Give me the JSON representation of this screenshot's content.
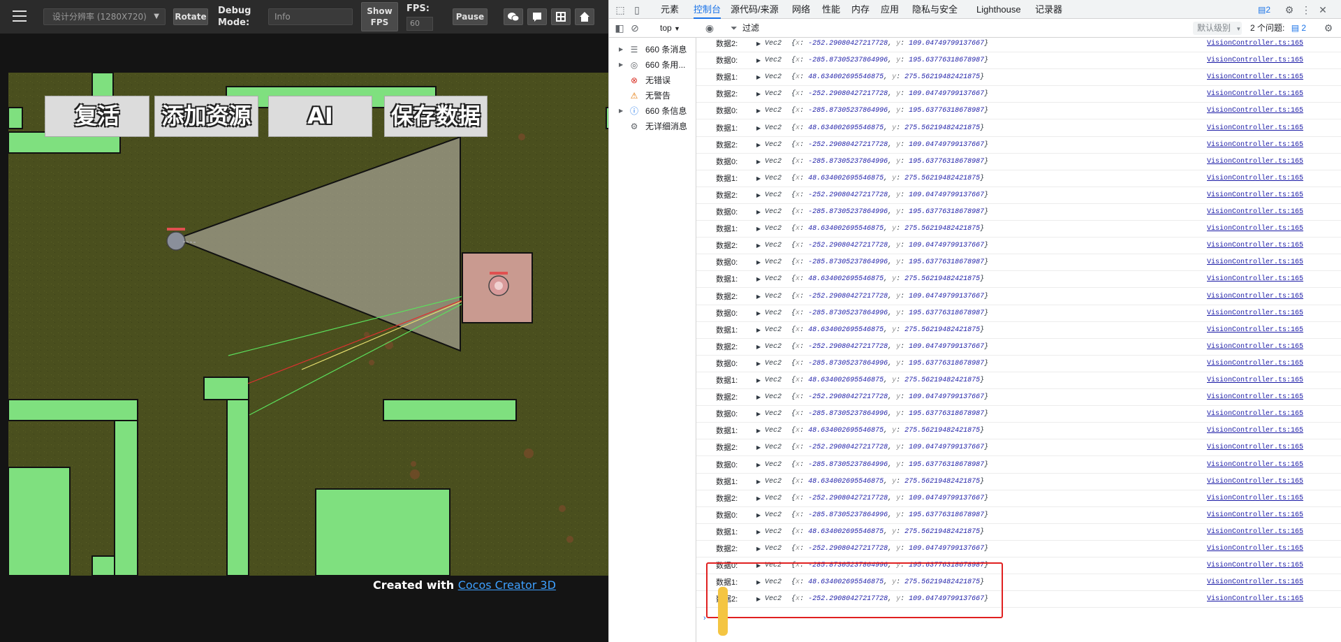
{
  "preview": {
    "resolution": "设计分辨率 (1280X720)",
    "rotate": "Rotate",
    "debug_label": "Debug Mode:",
    "debug_mode": "Info",
    "show_fps": "Show FPS",
    "fps_label": "FPS:",
    "fps_value": "60",
    "pause": "Pause",
    "icons": [
      "wechat-icon",
      "chat-icon",
      "grid-icon",
      "home-icon"
    ],
    "game_buttons": [
      "复活",
      "添加资源",
      "AI",
      "保存数据"
    ],
    "footer_prefix": "Created with ",
    "footer_link": "Cocos Creator 3D"
  },
  "devtools": {
    "tabs": [
      "元素",
      "控制台",
      "源代码/来源",
      "网络",
      "性能",
      "内存",
      "应用",
      "隐私与安全",
      "Lighthouse",
      "记录器"
    ],
    "active_tab": "控制台",
    "issues_badge": "2",
    "context": "top",
    "filter_placeholder": "过滤",
    "level": "默认级别",
    "issues_text": "2 个问题:",
    "issues_count": "2",
    "sidebar": [
      {
        "label": "660 条消息",
        "icon": "list-icon",
        "expandable": true
      },
      {
        "label": "660 条用...",
        "icon": "user-icon",
        "expandable": true
      },
      {
        "label": "无错误",
        "icon": "error-icon",
        "expandable": false
      },
      {
        "label": "无警告",
        "icon": "warning-icon",
        "expandable": false
      },
      {
        "label": "660 条信息",
        "icon": "info-icon",
        "expandable": true
      },
      {
        "label": "无详细消息",
        "icon": "bug-icon",
        "expandable": false
      }
    ],
    "log_entries": [
      {
        "prefix": "数据0:",
        "x": "-285.87305237864996",
        "y": "195.63776318678987"
      },
      {
        "prefix": "数据1:",
        "x": "48.634002695546875",
        "y": "275.56219482421875"
      },
      {
        "prefix": "数据2:",
        "x": "-252.29080427217728",
        "y": "109.04749799137667"
      }
    ],
    "first_entry_index": 2,
    "row_count": 34,
    "vec_class": "Vec2",
    "source": "VisionController.ts:165"
  }
}
